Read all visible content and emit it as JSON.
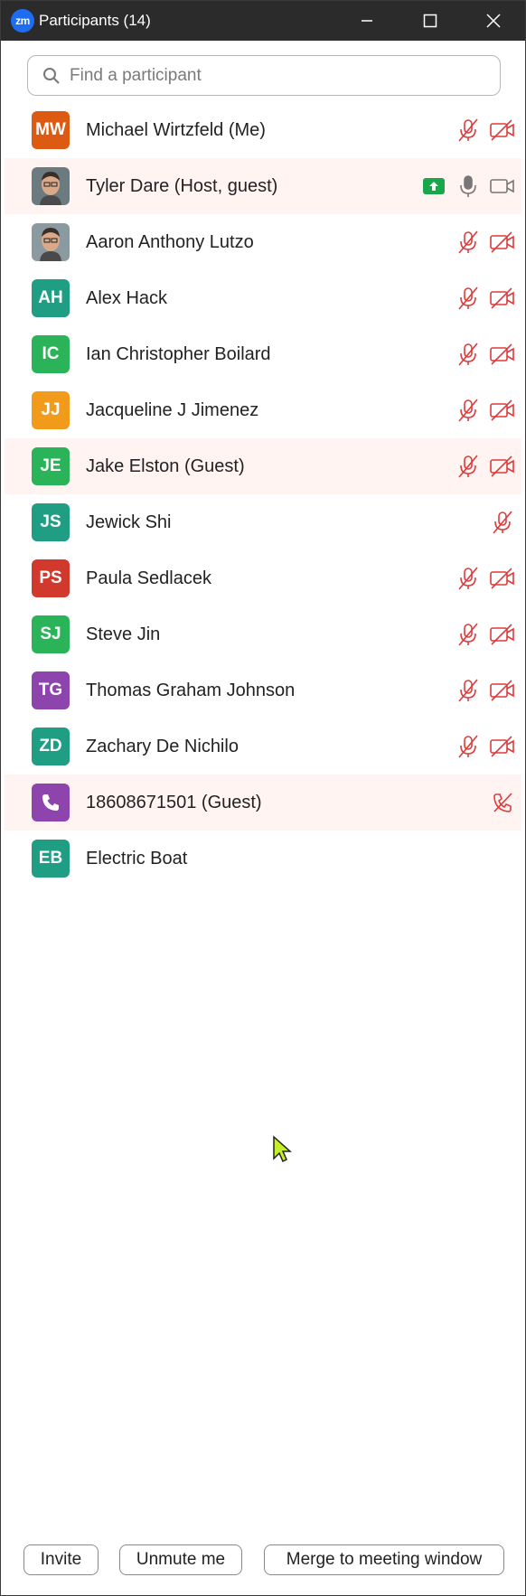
{
  "window": {
    "logo_text": "zm",
    "title": "Participants (14)"
  },
  "search": {
    "placeholder": "Find a participant",
    "value": ""
  },
  "colors": {
    "muted_red": "#e03a3a",
    "normal_gray": "#777777",
    "share_green": "#1aa64a"
  },
  "participants": [
    {
      "name": "Michael Wirtzfeld (Me)",
      "initials": "MW",
      "color": "#dd5a12",
      "mic": "muted",
      "video": "off"
    },
    {
      "name": "Tyler Dare (Host, guest)",
      "initials": "",
      "photo": true,
      "mic": "on",
      "video": "on",
      "sharing": true
    },
    {
      "name": "Aaron Anthony Lutzo",
      "initials": "",
      "photo": true,
      "mic": "muted",
      "video": "off"
    },
    {
      "name": "Alex Hack",
      "initials": "AH",
      "color": "#1f9e84",
      "mic": "muted",
      "video": "off"
    },
    {
      "name": "Ian Christopher Boilard",
      "initials": "IC",
      "color": "#2bb35a",
      "mic": "muted",
      "video": "off"
    },
    {
      "name": "Jacqueline J Jimenez",
      "initials": "JJ",
      "color": "#f29a1a",
      "mic": "muted",
      "video": "off"
    },
    {
      "name": "Jake Elston (Guest)",
      "initials": "JE",
      "color": "#2bb35a",
      "mic": "muted",
      "video": "off"
    },
    {
      "name": "Jewick Shi",
      "initials": "JS",
      "color": "#1f9e84",
      "mic": "muted",
      "video": "none"
    },
    {
      "name": "Paula Sedlacek",
      "initials": "PS",
      "color": "#d0392b",
      "mic": "muted",
      "video": "off"
    },
    {
      "name": "Steve Jin",
      "initials": "SJ",
      "color": "#2bb35a",
      "mic": "muted",
      "video": "off"
    },
    {
      "name": "Thomas Graham Johnson",
      "initials": "TG",
      "color": "#8e44ad",
      "mic": "muted",
      "video": "off"
    },
    {
      "name": "Zachary De Nichilo",
      "initials": "ZD",
      "color": "#1f9e84",
      "mic": "muted",
      "video": "off"
    },
    {
      "name": "18608671501 (Guest)",
      "initials": "",
      "phone": true,
      "color": "#8e44ad",
      "mic": "phone-muted",
      "video": "none"
    },
    {
      "name": "Electric Boat",
      "initials": "EB",
      "color": "#1f9e84",
      "mic": "none",
      "video": "none"
    }
  ],
  "footer": {
    "invite_label": "Invite",
    "unmute_label": "Unmute me",
    "merge_label": "Merge to meeting window"
  }
}
